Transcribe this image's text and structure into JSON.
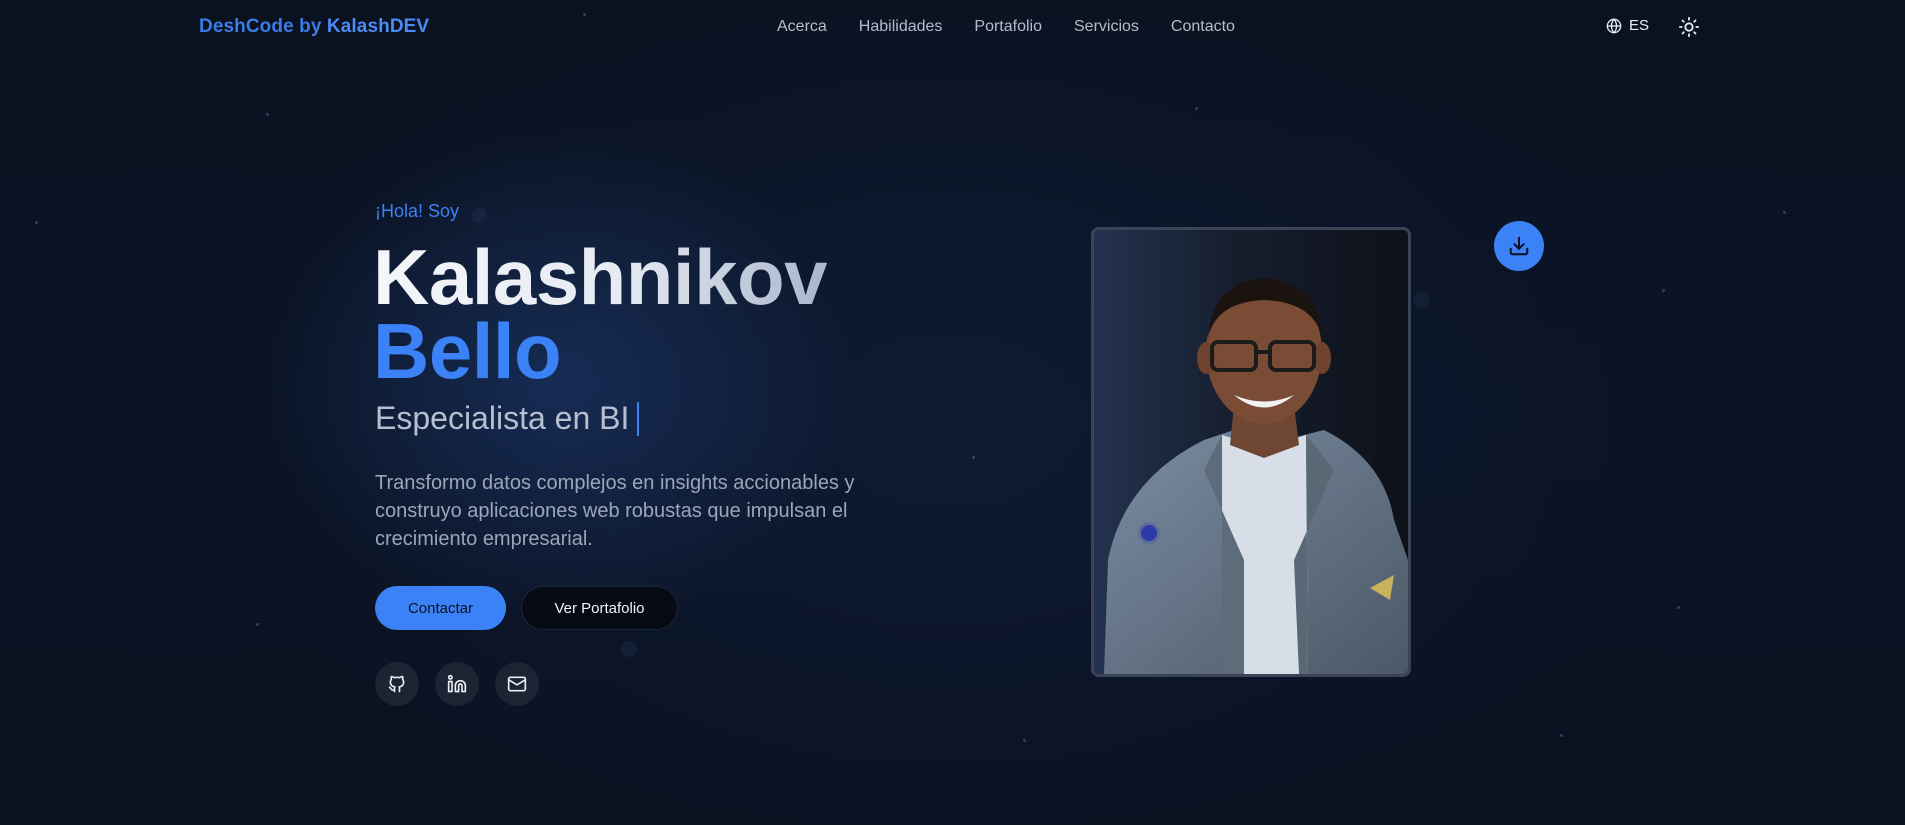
{
  "nav": {
    "brand_part1": "DeshCode",
    "brand_part2": " by ",
    "brand_part3": "KalashDEV",
    "links": [
      "Acerca",
      "Habilidades",
      "Portafolio",
      "Servicios",
      "Contacto"
    ],
    "language": "ES",
    "language_icon": "globe-icon",
    "theme_icon": "sun-icon"
  },
  "hero": {
    "greeting": "¡Hola! Soy",
    "first_name": "Kalashnikov",
    "last_name": "Bello",
    "role": "Especialista en BI",
    "description": "Transformo datos complejos en insights accionables y construyo aplicaciones web robustas que impulsan el crecimiento empresarial.",
    "primary_button": "Contactar",
    "secondary_button": "Ver Portafolio",
    "socials": [
      "github-icon",
      "linkedin-icon",
      "mail-icon"
    ],
    "download_icon": "download-icon"
  },
  "colors": {
    "accent": "#3b82f6",
    "background": "#0a1120"
  }
}
